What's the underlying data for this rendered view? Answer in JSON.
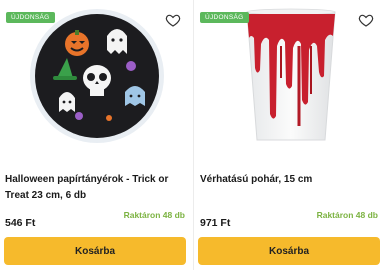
{
  "products": [
    {
      "badge": "ÚJDONSÁG",
      "title": "Halloween papírtányérok - Trick or Treat 23 cm, 6 db",
      "stock": "Raktáron 48 db",
      "price": "546 Ft",
      "button": "Kosárba",
      "icon": "heart-outline-icon"
    },
    {
      "badge": "ÚJDONSÁG",
      "title": "Vérhatású pohár, 15 cm",
      "stock": "Raktáron 48 db",
      "price": "971 Ft",
      "button": "Kosárba",
      "icon": "heart-outline-icon"
    }
  ],
  "colors": {
    "badge": "#5cb85c",
    "stock": "#7cb342",
    "button": "#f6ba2c"
  }
}
